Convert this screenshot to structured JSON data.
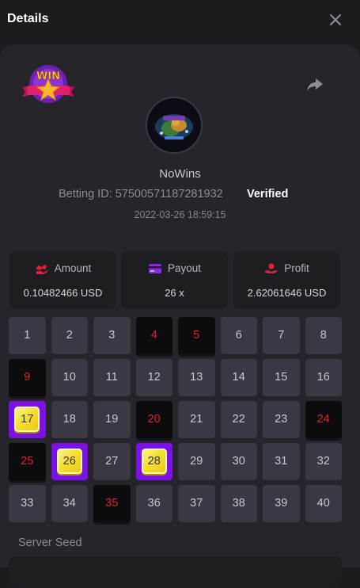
{
  "header": {
    "title": "Details"
  },
  "player": {
    "name": "NoWins",
    "betting_id_label": "Betting ID:",
    "betting_id": "575005711872819​32",
    "verified": "Verified",
    "datetime": "2022-03-26 18:59:15"
  },
  "stats": {
    "amount": {
      "label": "Amount",
      "value": "0.10482466 USD"
    },
    "payout": {
      "label": "Payout",
      "value": "26 x"
    },
    "profit": {
      "label": "Profit",
      "value": "2.62061646 USD"
    }
  },
  "keno_grid": {
    "numbers": [
      1,
      2,
      3,
      4,
      5,
      6,
      7,
      8,
      9,
      10,
      11,
      12,
      13,
      14,
      15,
      16,
      17,
      18,
      19,
      20,
      21,
      22,
      23,
      24,
      25,
      26,
      27,
      28,
      29,
      30,
      31,
      32,
      33,
      34,
      35,
      36,
      37,
      38,
      39,
      40
    ],
    "drawn_misses": [
      4,
      5,
      9,
      20,
      24,
      25,
      35
    ],
    "hits": [
      17,
      26,
      28
    ]
  },
  "seed": {
    "label": "Server Seed"
  },
  "colors": {
    "background": "#1c1c20",
    "panel": "#25252b",
    "hit": "#7a12e6",
    "miss_text": "#e0222c",
    "accent_icon": "#e0223a"
  }
}
